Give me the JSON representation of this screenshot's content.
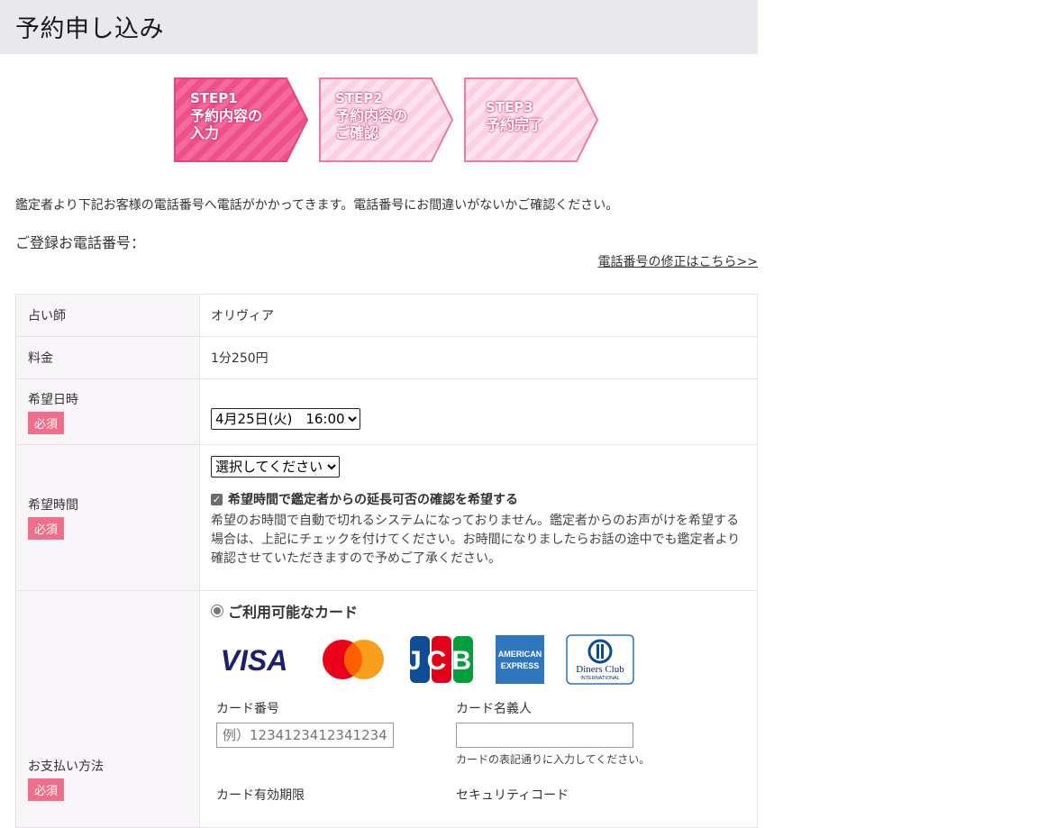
{
  "page": {
    "title": "予約申し込み"
  },
  "steps": [
    {
      "number": "STEP1",
      "line1": "予約内容の",
      "line2": "入力",
      "active": true
    },
    {
      "number": "STEP2",
      "line1": "予約内容の",
      "line2": "ご確認",
      "active": false
    },
    {
      "number": "STEP3",
      "line1": "予約完了",
      "line2": "",
      "active": false
    }
  ],
  "notice": "鑑定者より下記お客様の電話番号へ電話がかかってきます。電話番号にお間違いがないかご確認ください。",
  "registered_phone_label": "ご登録お電話番号：",
  "phone_fix_link": "電話番号の修正はこちら>>",
  "form": {
    "fortune_teller": {
      "label": "占い師",
      "value": "オリヴィア"
    },
    "price": {
      "label": "料金",
      "value": "1分250円"
    },
    "date": {
      "label": "希望日時",
      "required": "必須",
      "selected": "4月25日(火)　16:00"
    },
    "duration": {
      "label": "希望時間",
      "required": "必須",
      "selected": "選択してください",
      "checkbox_label": "希望時間で鑑定者からの延長可否の確認を希望する",
      "checkbox_checked": true,
      "description": "希望のお時間で自動で切れるシステムになっておりません。鑑定者からのお声がけを希望する場合は、上記にチェックを付けてください。お時間になりましたらお話の途中でも鑑定者より確認させていただきますので予めご了承ください。"
    },
    "payment": {
      "label": "お支払い方法",
      "required": "必須",
      "option_label": "ご利用可能なカード",
      "cards": [
        "VISA",
        "Mastercard",
        "JCB",
        "AMERICAN EXPRESS",
        "Diners Club INTERNATIONAL"
      ],
      "card_logos": {
        "visa": "VISA",
        "jcb": "JCB",
        "amex_line1": "AMERICAN",
        "amex_line2": "EXPRESS",
        "diners_line1": "Diners Club",
        "diners_line2": "INTERNATIONAL"
      },
      "card_number_label": "カード番号",
      "card_number_placeholder": "例）1234123412341234",
      "card_name_label": "カード名義人",
      "card_name_value": "",
      "card_name_help": "カードの表記通りに入力してください。",
      "expiry_label": "カード有効期限",
      "cvc_label": "セキュリティコード"
    }
  },
  "colors": {
    "header_bg": "#e9e8ec",
    "step_active": "#f0508a",
    "step_inactive": "#fde3ee",
    "required_badge": "#ee6e8b"
  }
}
